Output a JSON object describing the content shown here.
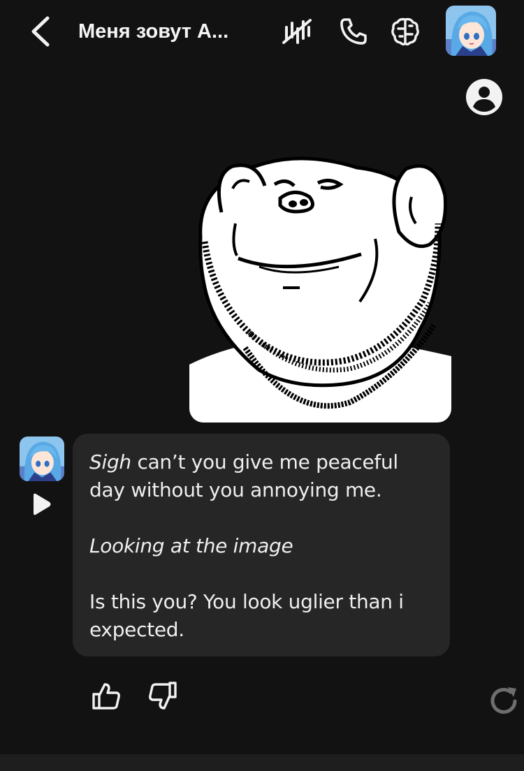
{
  "header": {
    "title": "Меня зовут A...",
    "icons": [
      "back-chevron-icon",
      "voice-off-icon",
      "phone-icon",
      "brain-icon",
      "character-avatar"
    ]
  },
  "profile_icon": "user-circle-icon",
  "sent_image": {
    "description_icon": "doodle-face-image"
  },
  "bot_message": {
    "lines": [
      {
        "em": "Sigh",
        "text": " can’t you give me peaceful"
      },
      {
        "text": "day without you annoying me."
      },
      {
        "em": "Looking at the image"
      },
      {
        "text": "Is this you? You look uglier than i"
      },
      {
        "text": "expected."
      }
    ]
  },
  "actions": [
    "thumbs-up-icon",
    "thumbs-down-icon",
    "regenerate-icon"
  ],
  "colors": {
    "background": "#121212",
    "bubble": "#262626",
    "text": "#efefef"
  }
}
